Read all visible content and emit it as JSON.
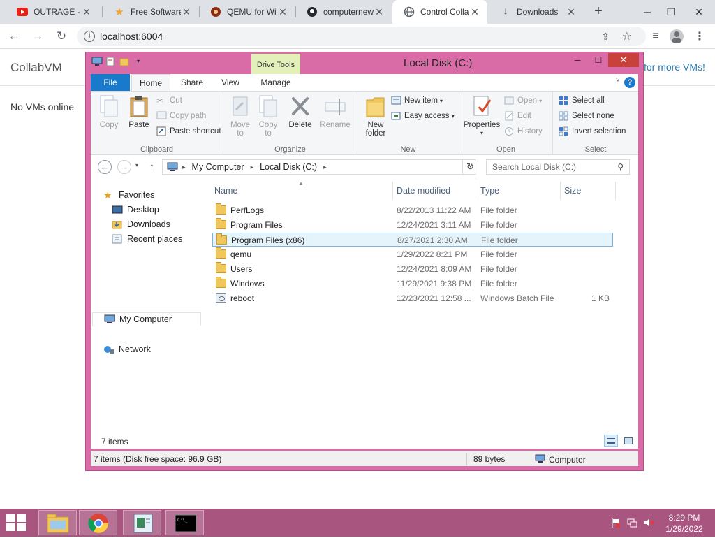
{
  "browser": {
    "tabs": [
      {
        "title": "OUTRAGE - w",
        "icon": "youtube-icon",
        "active": false
      },
      {
        "title": "Free Software",
        "icon": "star-icon",
        "active": false
      },
      {
        "title": "QEMU for Wi",
        "icon": "qemu-icon",
        "active": false
      },
      {
        "title": "computernew",
        "icon": "github-icon",
        "active": false
      },
      {
        "title": "Control Colla",
        "icon": "globe-icon",
        "active": true
      },
      {
        "title": "Downloads",
        "icon": "download-icon",
        "active": false
      }
    ],
    "close_glyph": "✕",
    "newtab_glyph": "+",
    "url": "localhost:6004"
  },
  "page": {
    "brand": "CollabVM",
    "more_vms": "for more VMs!",
    "no_vms": "No VMs online"
  },
  "explorer": {
    "title": "Local Disk (C:)",
    "drive_tools_label": "Drive Tools",
    "ribbon_tabs": [
      "File",
      "Home",
      "Share",
      "View",
      "Manage"
    ],
    "clipboard": {
      "copy": "Copy",
      "paste": "Paste",
      "cut": "Cut",
      "copy_path": "Copy path",
      "paste_shortcut": "Paste shortcut",
      "label": "Clipboard"
    },
    "organize": {
      "move_to": "Move",
      "move_to_2": "to",
      "copy_to": "Copy",
      "copy_to_2": "to",
      "delete": "Delete",
      "rename": "Rename",
      "label": "Organize"
    },
    "new_group": {
      "new_folder": "New",
      "new_folder_2": "folder",
      "new_item": "New item",
      "easy_access": "Easy access",
      "label": "New"
    },
    "open_group": {
      "properties": "Properties",
      "open": "Open",
      "edit": "Edit",
      "history": "History",
      "label": "Open"
    },
    "select_group": {
      "select_all": "Select all",
      "select_none": "Select none",
      "invert": "Invert selection",
      "label": "Select"
    },
    "breadcrumb": [
      "My Computer",
      "Local Disk (C:)"
    ],
    "search_placeholder": "Search Local Disk (C:)",
    "nav": {
      "favorites": "Favorites",
      "desktop": "Desktop",
      "downloads": "Downloads",
      "recent": "Recent places",
      "my_computer": "My Computer",
      "network": "Network"
    },
    "columns": [
      "Name",
      "Date modified",
      "Type",
      "Size"
    ],
    "files": [
      {
        "name": "PerfLogs",
        "date": "8/22/2013 11:22 AM",
        "type": "File folder",
        "size": "",
        "kind": "folder",
        "selected": false
      },
      {
        "name": "Program Files",
        "date": "12/24/2021 3:11 AM",
        "type": "File folder",
        "size": "",
        "kind": "folder",
        "selected": false
      },
      {
        "name": "Program Files (x86)",
        "date": "8/27/2021 2:30 AM",
        "type": "File folder",
        "size": "",
        "kind": "folder",
        "selected": true
      },
      {
        "name": "qemu",
        "date": "1/29/2022 8:21 PM",
        "type": "File folder",
        "size": "",
        "kind": "folder",
        "selected": false
      },
      {
        "name": "Users",
        "date": "12/24/2021 8:09 AM",
        "type": "File folder",
        "size": "",
        "kind": "folder",
        "selected": false
      },
      {
        "name": "Windows",
        "date": "11/29/2021 9:38 PM",
        "type": "File folder",
        "size": "",
        "kind": "folder",
        "selected": false
      },
      {
        "name": "reboot",
        "date": "12/23/2021 12:58 ...",
        "type": "Windows Batch File",
        "size": "1 KB",
        "kind": "batch",
        "selected": false
      }
    ],
    "item_count": "7 items",
    "status": {
      "left": "7 items (Disk free space: 96.9 GB)",
      "middle": "89 bytes",
      "right": "Computer"
    }
  },
  "taskbar": {
    "time": "8:29 PM",
    "date": "1/29/2022"
  },
  "colors": {
    "window_frame": "#d96ca6",
    "taskbar": "#a8557f",
    "file_tab": "#1979ca",
    "close_button": "#c8413b"
  }
}
